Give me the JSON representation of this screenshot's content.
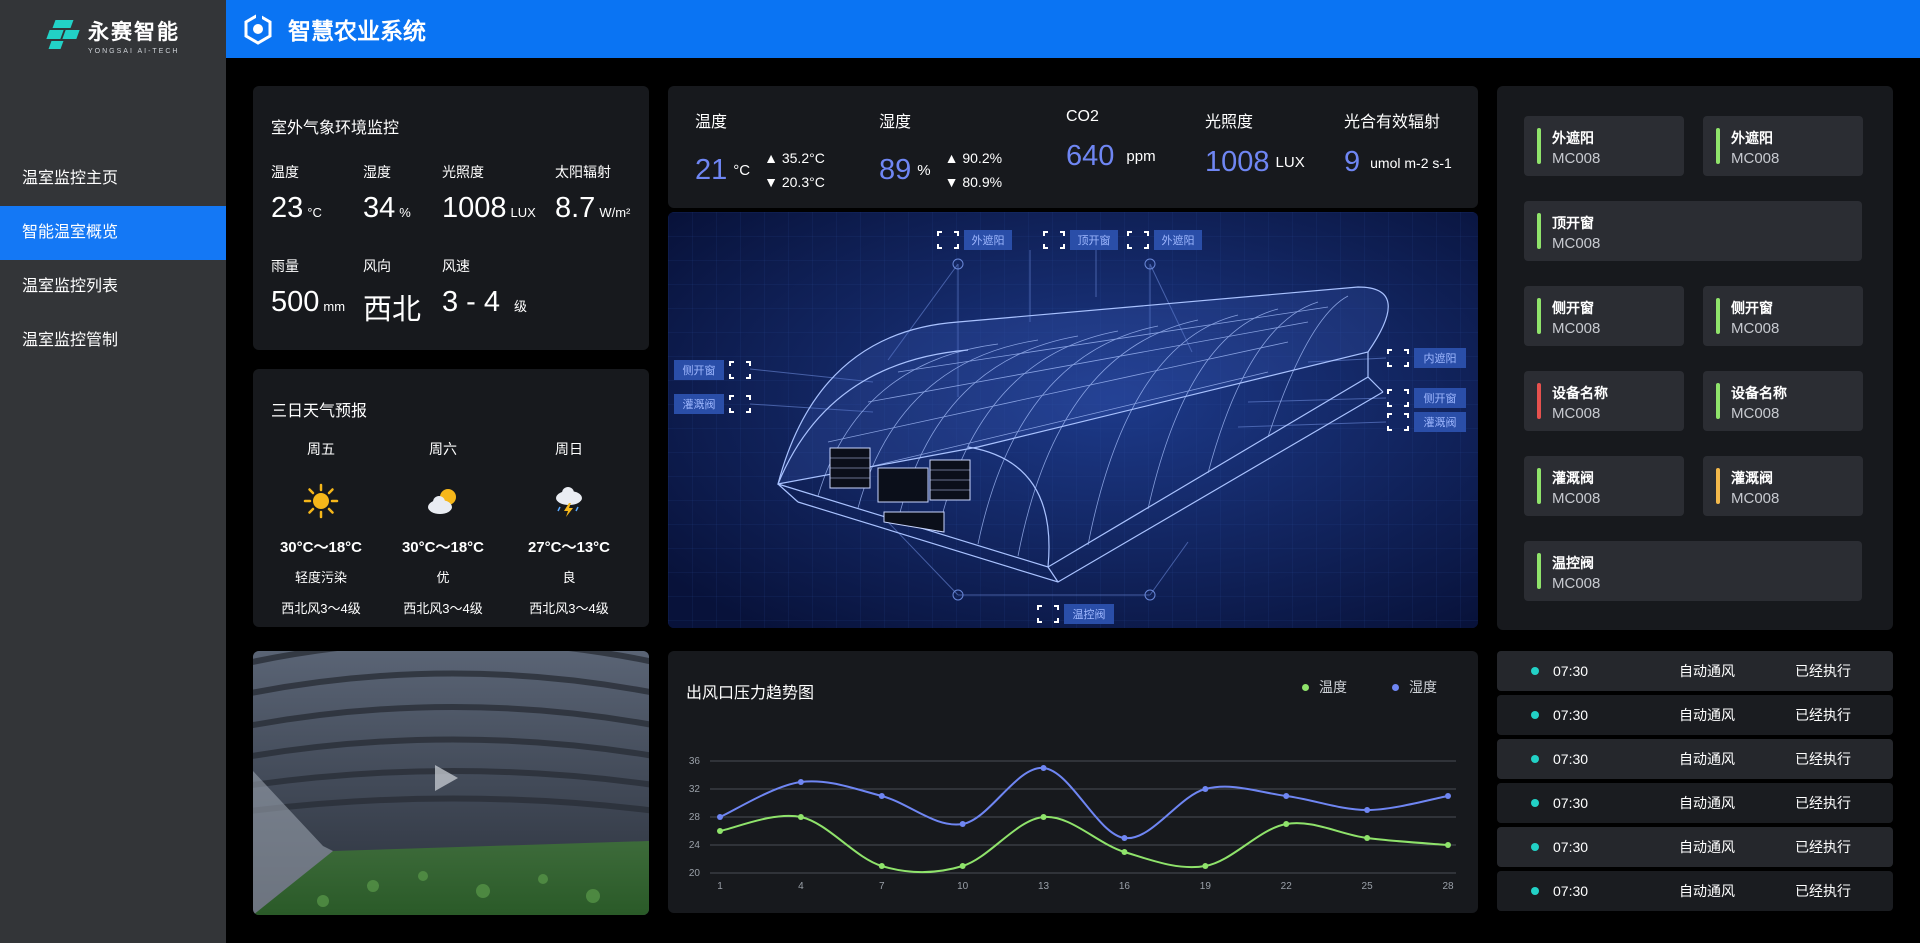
{
  "brand": {
    "name": "永赛智能",
    "sub": "YONGSAI AI-TECH"
  },
  "sidebar": {
    "items": [
      {
        "label": "温室监控主页",
        "active": false
      },
      {
        "label": "智能温室概览",
        "active": true
      },
      {
        "label": "温室监控列表",
        "active": false
      },
      {
        "label": "温室监控管制",
        "active": false
      }
    ]
  },
  "header": {
    "title": "智慧农业系统"
  },
  "outdoor": {
    "title": "室外气象环境监控",
    "metrics": [
      {
        "label": "温度",
        "value": "23",
        "unit": "°C"
      },
      {
        "label": "湿度",
        "value": "34",
        "unit": "%"
      },
      {
        "label": "光照度",
        "value": "1008",
        "unit": "LUX"
      },
      {
        "label": "太阳辐射",
        "value": "8.7",
        "unit": "W/m²"
      },
      {
        "label": "雨量",
        "value": "500",
        "unit": "mm"
      },
      {
        "label": "风向",
        "value": "西北",
        "unit": ""
      },
      {
        "label": "风速",
        "value": "3 - 4",
        "unit": "级"
      }
    ]
  },
  "forecast": {
    "title": "三日天气预报",
    "days": [
      {
        "day": "周五",
        "icon": "sun-icon",
        "temp": "30°C～18°C",
        "aq": "轻度污染",
        "wind": "西北风3～4级"
      },
      {
        "day": "周六",
        "icon": "partly-cloudy-icon",
        "temp": "30°C～18°C",
        "aq": "优",
        "wind": "西北风3～4级"
      },
      {
        "day": "周日",
        "icon": "thunderstorm-icon",
        "temp": "27°C～13°C",
        "aq": "良",
        "wind": "西北风3～4级"
      }
    ]
  },
  "sensors": [
    {
      "label": "温度",
      "value": "21",
      "unit": "°C",
      "max": "35.2°C",
      "min": "20.3°C"
    },
    {
      "label": "湿度",
      "value": "89",
      "unit": "%",
      "max": "90.2%",
      "min": "80.9%"
    },
    {
      "label": "CO2",
      "value": "640",
      "unit": "ppm"
    },
    {
      "label": "光照度",
      "value": "1008",
      "unit": "LUX"
    },
    {
      "label": "光合有效辐射",
      "value": "9",
      "unit": "umol m-2 s-1"
    }
  ],
  "greenhouse_tags": {
    "top1": "外遮阳",
    "top2": "顶开窗",
    "top3": "外遮阳",
    "inner_shade": "内遮阳",
    "side_right": "侧开窗",
    "irrigation_right": "灌溉阀",
    "side_left": "侧开窗",
    "irrigation_left": "灌溉阀",
    "temp_valve": "温控阀"
  },
  "devices": [
    {
      "name": "外遮阳",
      "code": "MC008",
      "status": "#8fe36b"
    },
    {
      "name": "外遮阳",
      "code": "MC008",
      "status": "#8fe36b"
    },
    {
      "name": "顶开窗",
      "code": "MC008",
      "status": "#8fe36b"
    },
    {
      "name": "侧开窗",
      "code": "MC008",
      "status": "#8fe36b"
    },
    {
      "name": "侧开窗",
      "code": "MC008",
      "status": "#8fe36b"
    },
    {
      "name": "设备名称",
      "code": "MC008",
      "status": "#e6514e"
    },
    {
      "name": "设备名称",
      "code": "MC008",
      "status": "#8fe36b"
    },
    {
      "name": "灌溉阀",
      "code": "MC008",
      "status": "#8fe36b"
    },
    {
      "name": "灌溉阀",
      "code": "MC008",
      "status": "#f2b84b"
    },
    {
      "name": "温控阀",
      "code": "MC008",
      "status": "#8fe36b"
    }
  ],
  "log": [
    {
      "time": "07:30",
      "action": "自动通风",
      "status": "已经执行"
    },
    {
      "time": "07:30",
      "action": "自动通风",
      "status": "已经执行"
    },
    {
      "time": "07:30",
      "action": "自动通风",
      "status": "已经执行"
    },
    {
      "time": "07:30",
      "action": "自动通风",
      "status": "已经执行"
    },
    {
      "time": "07:30",
      "action": "自动通风",
      "status": "已经执行"
    },
    {
      "time": "07:30",
      "action": "自动通风",
      "status": "已经执行"
    }
  ],
  "chart_data": {
    "type": "line",
    "title": "出风口压力趋势图",
    "x": [
      1,
      4,
      7,
      10,
      13,
      16,
      19,
      22,
      25,
      28
    ],
    "series": [
      {
        "name": "温度",
        "color": "#8fe36b",
        "values": [
          26,
          28,
          21,
          21,
          28,
          23,
          21,
          27,
          25,
          24
        ]
      },
      {
        "name": "湿度",
        "color": "#6f86f3",
        "values": [
          28,
          33,
          31,
          27,
          35,
          25,
          32,
          31,
          29,
          31
        ]
      }
    ],
    "yticks": [
      20,
      24,
      28,
      32,
      36
    ],
    "ylim": [
      20,
      36
    ],
    "grid": true,
    "legend": "top-right"
  }
}
